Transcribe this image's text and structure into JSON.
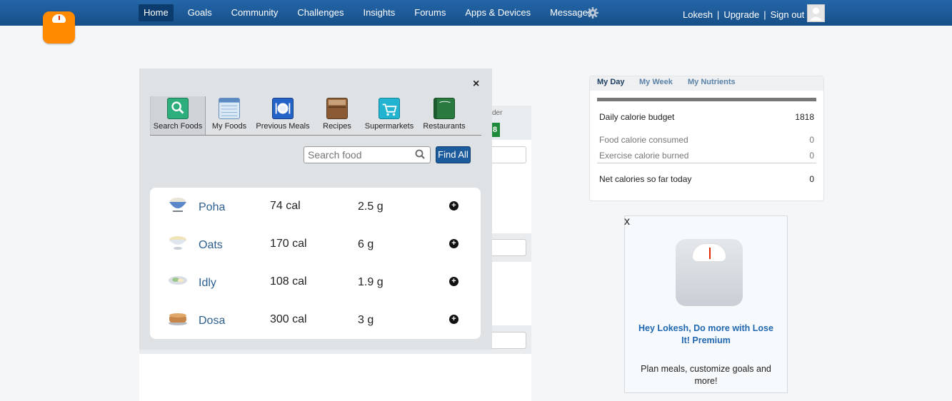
{
  "nav": {
    "items": [
      "Home",
      "Goals",
      "Community",
      "Challenges",
      "Insights",
      "Forums",
      "Apps & Devices",
      "Messages"
    ],
    "active": "Home",
    "user": "Lokesh",
    "upgrade": "Upgrade",
    "signout": "Sign out",
    "separator": "|"
  },
  "background": {
    "ender_text": "der",
    "badge_text": "8"
  },
  "popup": {
    "close_label": "×",
    "tabs": [
      {
        "label": "Search Foods",
        "icon": "search-foods-icon"
      },
      {
        "label": "My Foods",
        "icon": "my-foods-icon"
      },
      {
        "label": "Previous Meals",
        "icon": "previous-meals-icon"
      },
      {
        "label": "Recipes",
        "icon": "recipes-icon"
      },
      {
        "label": "Supermarkets",
        "icon": "supermarkets-icon"
      },
      {
        "label": "Restaurants",
        "icon": "restaurants-icon"
      }
    ],
    "search_placeholder": "Search food",
    "find_all": "Find All",
    "foods": [
      {
        "name": "Poha",
        "cal": "74 cal",
        "carb": "2.5 g",
        "icon": "bowl-food-icon"
      },
      {
        "name": "Oats",
        "cal": "170 cal",
        "carb": "6 g",
        "icon": "oats-bowl-icon"
      },
      {
        "name": "Idly",
        "cal": "108 cal",
        "carb": "1.9 g",
        "icon": "plate-food-icon"
      },
      {
        "name": "Dosa",
        "cal": "300 cal",
        "carb": "3 g",
        "icon": "pancake-stack-icon"
      }
    ]
  },
  "day": {
    "tabs": [
      "My Day",
      "My Week",
      "My Nutrients"
    ],
    "budget_label": "Daily calorie budget",
    "budget_value": "1818",
    "consumed_label": "Food calorie consumed",
    "consumed_value": "0",
    "burned_label": "Exercise calorie burned",
    "burned_value": "0",
    "net_label": "Net calories so far today",
    "net_value": "0"
  },
  "promo": {
    "close_label": "x",
    "title": "Hey Lokesh, Do more with Lose It! Premium",
    "text": "Plan meals, customize goals and more!"
  },
  "colors": {
    "topbar": "#1d5d9b",
    "logo": "#ff8a00",
    "accent_link": "#2067b0"
  }
}
